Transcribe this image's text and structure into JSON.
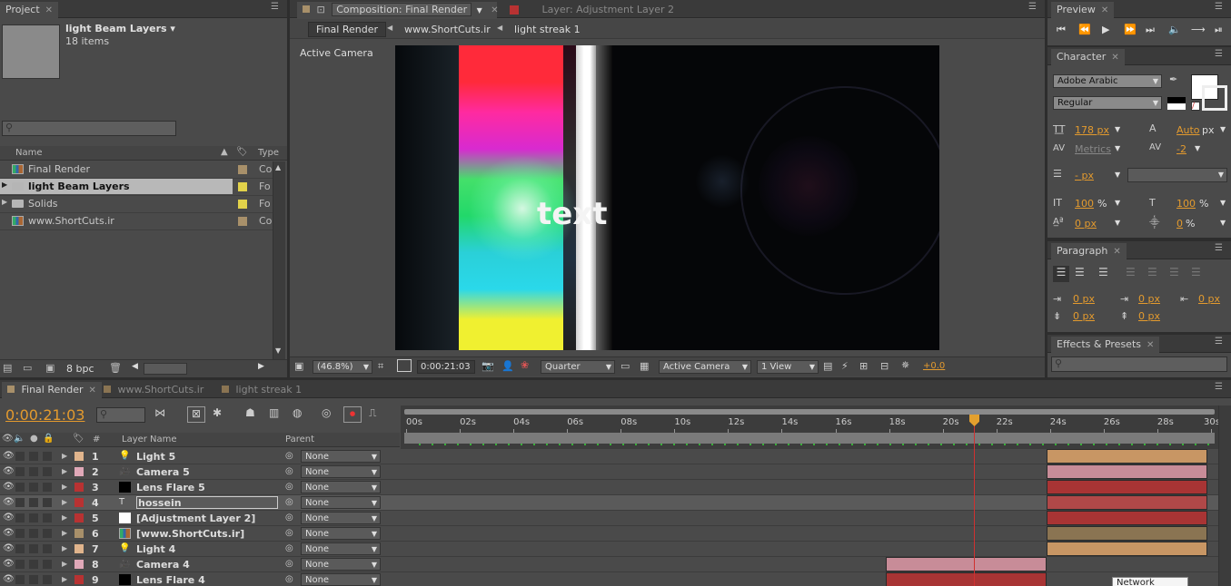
{
  "project": {
    "tab_label": "Project",
    "selected_name": "light Beam Layers",
    "selected_items": "18 items",
    "search_placeholder": "",
    "col_name": "Name",
    "col_type": "Type",
    "bpc": "8 bpc",
    "items": [
      {
        "name": "Final Render",
        "type": "Co",
        "color": "#a8906a",
        "icon": "composition-icon"
      },
      {
        "name": "light Beam Layers",
        "type": "Fo",
        "color": "#e2d24a",
        "icon": "folder-icon"
      },
      {
        "name": "Solids",
        "type": "Fo",
        "color": "#e2d24a",
        "icon": "folder-icon"
      },
      {
        "name": "www.ShortCuts.ir",
        "type": "Co",
        "color": "#a8906a",
        "icon": "composition-icon"
      }
    ]
  },
  "composition": {
    "tab_label": "Composition: Final Render",
    "layer_tab_label": "Layer: Adjustment Layer 2",
    "breadcrumbs": [
      "Final Render",
      "www.ShortCuts.ir",
      "light streak 1"
    ],
    "camera_label": "Active Camera",
    "viewer_text": "text",
    "zoom": "(46.8%)",
    "timecode": "0:00:21:03",
    "resolution": "Quarter",
    "camera_select": "Active Camera",
    "views_select": "1 View",
    "exposure": "+0.0"
  },
  "preview": {
    "tab_label": "Preview"
  },
  "character": {
    "tab_label": "Character",
    "font": "Adobe Arabic",
    "style": "Regular",
    "size": "178 px",
    "leading": "Auto",
    "leading_unit": "px",
    "kerning": "Metrics",
    "tracking": "-2",
    "stroke": "- px",
    "vscale": "100",
    "vscale_unit": "%",
    "hscale": "100",
    "hscale_unit": "%",
    "baseline": "0 px",
    "tsume": "0",
    "tsume_unit": "%"
  },
  "paragraph": {
    "tab_label": "Paragraph",
    "indent_left": "0 px",
    "indent_first": "0 px",
    "indent_right": "0 px",
    "space_before": "0 px",
    "space_after": "0 px"
  },
  "effects": {
    "tab_label": "Effects & Presets"
  },
  "timeline": {
    "tabs": [
      "Final Render",
      "www.ShortCuts.ir",
      "light streak 1"
    ],
    "timecode": "0:00:21:03",
    "col_layer_name": "Layer Name",
    "col_parent": "Parent",
    "col_hash": "#",
    "ruler": [
      "00s",
      "02s",
      "04s",
      "06s",
      "08s",
      "10s",
      "12s",
      "14s",
      "16s",
      "18s",
      "20s",
      "22s",
      "24s",
      "26s",
      "28s",
      "30s"
    ],
    "layers": [
      {
        "num": "1",
        "name": "Light 5",
        "label_color": "#e0b48c",
        "icon": "light-icon",
        "parent": "None",
        "bar_color": "#c89664",
        "bar_start": 24.0,
        "bar_end": 30.0
      },
      {
        "num": "2",
        "name": "Camera 5",
        "label_color": "#e0a8b8",
        "icon": "camera-icon",
        "parent": "None",
        "bar_color": "#c88c98",
        "bar_start": 24.0,
        "bar_end": 30.0
      },
      {
        "num": "3",
        "name": "Lens Flare 5",
        "label_color": "#b83232",
        "icon": "solid-icon",
        "parent": "None",
        "bar_color": "#a83434",
        "bar_start": 24.0,
        "bar_end": 30.0
      },
      {
        "num": "4",
        "name": "hossein",
        "label_color": "#b83232",
        "icon": "text-icon",
        "parent": "None",
        "bar_color": "#b04848",
        "bar_start": 24.0,
        "bar_end": 30.0
      },
      {
        "num": "5",
        "name": "[Adjustment Layer 2]",
        "label_color": "#b83232",
        "icon": "adjustment-icon",
        "parent": "None",
        "bar_color": "#a83434",
        "bar_start": 24.0,
        "bar_end": 30.0
      },
      {
        "num": "6",
        "name": "[www.ShortCuts.ir]",
        "label_color": "#a8906a",
        "icon": "composition-icon",
        "parent": "None",
        "bar_color": "#8a7452",
        "bar_start": 24.0,
        "bar_end": 30.0
      },
      {
        "num": "7",
        "name": "Light 4",
        "label_color": "#e0b48c",
        "icon": "light-icon",
        "parent": "None",
        "bar_color": "#c89664",
        "bar_start": 24.0,
        "bar_end": 30.0
      },
      {
        "num": "8",
        "name": "Camera 4",
        "label_color": "#e0a8b8",
        "icon": "camera-icon",
        "parent": "None",
        "bar_color": "#c88c98",
        "bar_start": 18.0,
        "bar_end": 24.0
      },
      {
        "num": "9",
        "name": "Lens Flare 4",
        "label_color": "#b83232",
        "icon": "solid-icon",
        "parent": "None",
        "bar_color": "#a83434",
        "bar_start": 18.0,
        "bar_end": 24.0
      }
    ],
    "tooltip": "Network"
  }
}
